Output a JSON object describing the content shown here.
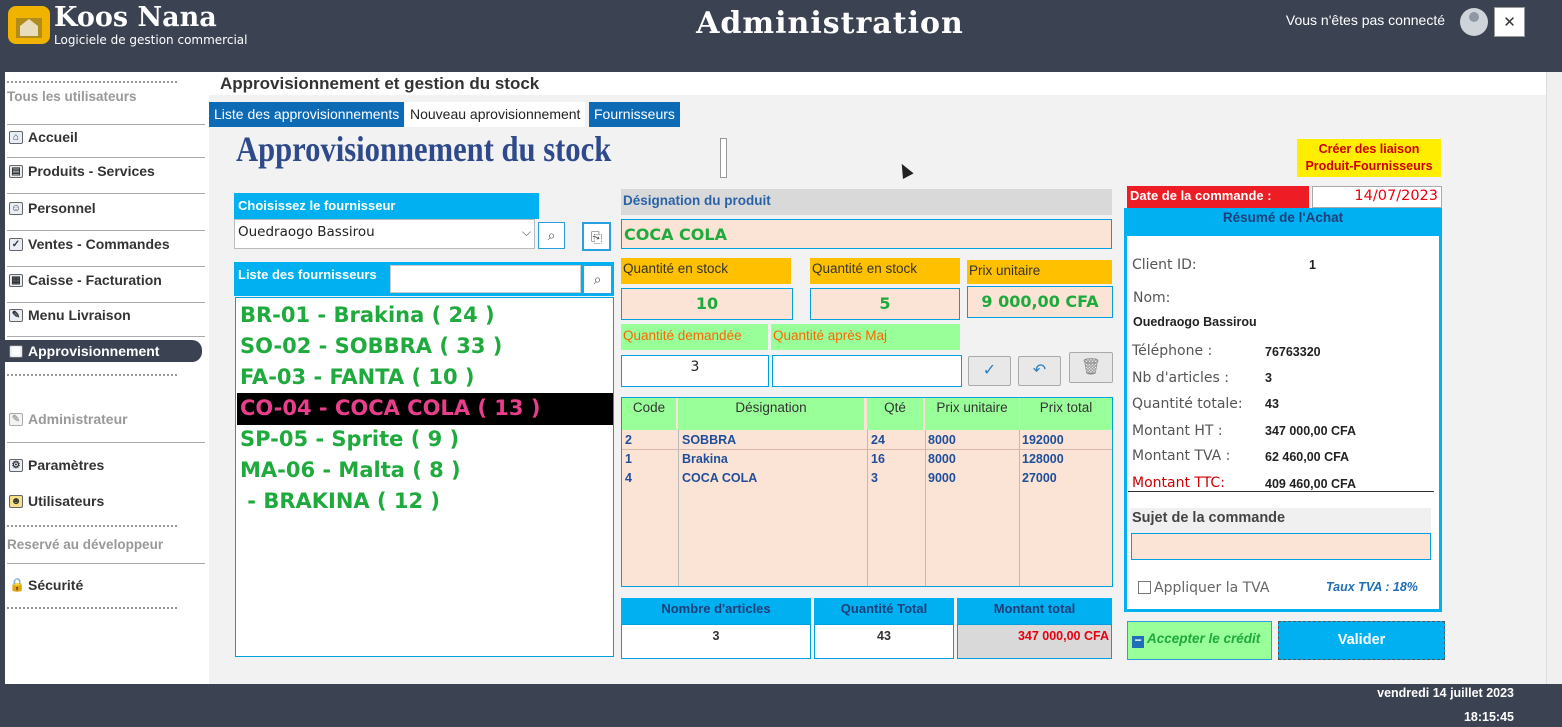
{
  "header": {
    "app_name": "Koos Nana",
    "app_subtitle": "Logiciele de gestion commercial",
    "title": "Administration",
    "connection_status": "Vous n'êtes pas connecté",
    "close_label": "✕"
  },
  "sidebar": {
    "all_users_label": "Tous les utilisateurs",
    "items": [
      {
        "label": "Accueil",
        "icon": "home-icon"
      },
      {
        "label": "Produits - Services",
        "icon": "products-icon"
      },
      {
        "label": "Personnel",
        "icon": "personnel-icon"
      },
      {
        "label": "Ventes - Commandes",
        "icon": "checkbox-icon"
      },
      {
        "label": "Caisse - Facturation",
        "icon": "cash-register-icon"
      },
      {
        "label": "Menu Livraison",
        "icon": "delivery-icon"
      },
      {
        "label": "Approvisionnement",
        "icon": "supply-icon",
        "active": true
      }
    ],
    "admin_label": "Administrateur",
    "admin_items": [
      {
        "label": "Paramètres",
        "icon": "settings-icon"
      },
      {
        "label": "Utilisateurs",
        "icon": "users-icon"
      }
    ],
    "dev_label": "Reservé au développeur",
    "dev_items": [
      {
        "label": "Sécurité",
        "icon": "lock-icon"
      }
    ]
  },
  "page": {
    "section_title": "Approvisionnement et gestion du stock",
    "tabs": [
      "Liste des approvisionnements",
      "Nouveau aprovisionnement",
      "Fournisseurs"
    ],
    "active_tab": 1,
    "big_title": "Approvisionnement du stock",
    "liaison_button": "Créer des liaison Produit-Fournisseurs"
  },
  "supplier": {
    "choose_label": "Choisissez le fournisseur",
    "selected": "Ouedraogo Bassirou",
    "list_label": "Liste des fournisseurs",
    "search_value": "",
    "items": [
      "BR-01 - Brakina ( 24 )",
      "SO-02 - SOBBRA ( 33 )",
      "FA-03 - FANTA ( 10 )",
      "CO-04 - COCA COLA ( 13 )",
      "SP-05 - Sprite ( 9 )",
      "MA-06 - Malta ( 8 )",
      " - BRAKINA ( 12 )"
    ],
    "selected_index": 3
  },
  "product": {
    "designation_label": "Désignation du produit",
    "designation": "COCA COLA",
    "stock_label_1": "Quantité en stock",
    "stock_value_1": "10",
    "stock_label_2": "Quantité en stock",
    "stock_value_2": "5",
    "price_label": "Prix unitaire",
    "price_value": "9 000,00 CFA",
    "qty_requested_label": "Quantité demandée",
    "qty_requested": "3",
    "qty_after_label": "Quantité après Maj",
    "qty_after": ""
  },
  "table": {
    "headers": [
      "Code",
      "Désignation",
      "Qté",
      "Prix unitaire",
      "Prix total"
    ],
    "rows": [
      {
        "code": "2",
        "designation": "SOBBRA",
        "qty": "24",
        "unit": "8000",
        "total": "192000"
      },
      {
        "code": "1",
        "designation": "Brakina",
        "qty": "16",
        "unit": "8000",
        "total": "128000"
      },
      {
        "code": "4",
        "designation": "COCA COLA",
        "qty": "3",
        "unit": "9000",
        "total": "27000"
      }
    ]
  },
  "totals": {
    "articles_label": "Nombre d'articles",
    "articles": "3",
    "qty_label": "Quantité Total",
    "qty": "43",
    "amount_label": "Montant total",
    "amount": "347 000,00 CFA"
  },
  "summary": {
    "date_label": "Date de la commande :",
    "date_value": "14/07/2023",
    "title": "Résumé de l'Achat",
    "client_id_label": "Client ID:",
    "client_id": "1",
    "name_label": "Nom:",
    "name": "Ouedraogo Bassirou",
    "phone_label": "Téléphone :",
    "phone": "76763320",
    "nb_label": "Nb d'articles :",
    "nb": "3",
    "qty_label": "Quantité totale:",
    "qty": "43",
    "ht_label": "Montant HT :",
    "ht": "347 000,00 CFA",
    "tva_label": "Montant TVA :",
    "tva": "62 460,00 CFA",
    "ttc_label": "Montant TTC:",
    "ttc": "409 460,00 CFA",
    "subject_label": "Sujet de la commande",
    "subject": "",
    "apply_tva_label": "Appliquer la TVA",
    "apply_tva": false,
    "tva_rate": "Taux TVA : 18%"
  },
  "actions": {
    "credit_label": "Accepter le crédit",
    "validate_label": "Valider"
  },
  "footer": {
    "date": "vendredi 14 juillet 2023",
    "time": "18:15:45"
  },
  "colors": {
    "topbar": "#3b4252",
    "accent": "#00b0f0",
    "tab_blue": "#0d6ab5",
    "green_text": "#1faa3e",
    "selected_pink": "#e83e8c",
    "peach": "#fbe4d5",
    "yellow": "#ffc000",
    "red": "#ee1c24"
  }
}
